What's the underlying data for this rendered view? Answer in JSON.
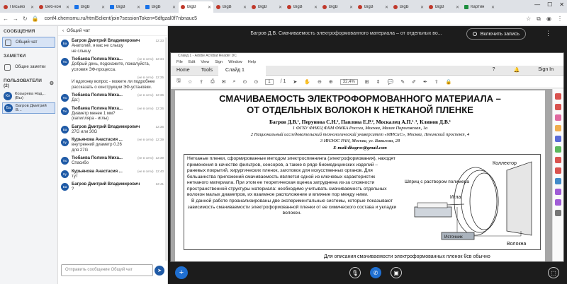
{
  "browser": {
    "tabs": [
      {
        "label": "Письмо",
        "fav": "red"
      },
      {
        "label": "Веб-кон",
        "fav": "red"
      },
      {
        "label": "BigB",
        "fav": "blue"
      },
      {
        "label": "BigB",
        "fav": "blue"
      },
      {
        "label": "BigB",
        "fav": "blue"
      },
      {
        "label": "BigB",
        "fav": "red",
        "active": true
      },
      {
        "label": "BigB",
        "fav": "red"
      },
      {
        "label": "BigB",
        "fav": "red"
      },
      {
        "label": "BigB",
        "fav": "red"
      },
      {
        "label": "BigB",
        "fav": "red"
      },
      {
        "label": "BigB",
        "fav": "red"
      },
      {
        "label": "BigB",
        "fav": "red"
      },
      {
        "label": "BigB",
        "fav": "red"
      },
      {
        "label": "Картин",
        "fav": "green"
      }
    ],
    "url": "conf4.chemsmu.ru/html5client/join?sessionToken=5dfgzal0f7nbnauc5"
  },
  "leftnav": {
    "messages_title": "СООБЩЕНИЯ",
    "public_chat": "Общий чат",
    "notes_title": "ЗАМЕТКИ",
    "shared_notes": "Общие заметки",
    "users_title": "ПОЛЬЗОВАТЕЛИ (2)",
    "users": [
      {
        "initials": "Ко",
        "name": "Козырева Над... (Вы)"
      },
      {
        "initials": "Ба",
        "name": "Багров Дмитрий В..."
      }
    ]
  },
  "chat": {
    "title": "Общий чат",
    "input_placeholder": "Отправить сообщение Общий чат",
    "messages": [
      {
        "initials": "Ба",
        "name": "Багров Дмитрий Владимирович",
        "time": "12:33",
        "status": "",
        "text": "Анатолий, я вас не слышу\nне слышу",
        "color": "#1f5aa6"
      },
      {
        "initials": "Тю",
        "name": "Тюбаева Полина Миха...",
        "time": "12:34",
        "status": "(не в сети)",
        "text": "Добрый день, подскажите, пожалуйста, условия ЭФ-процесса.",
        "color": "#1f5aa6"
      },
      {
        "initials": "",
        "name": "",
        "time": "12:35",
        "status": "(не в сети)",
        "text": "И вдогонку вопрос - можете ли подробнее рассказать о конструкции ЭФ-установки.",
        "color": "#1f5aa6"
      },
      {
        "initials": "Тю",
        "name": "Тюбаева Полина Миха...",
        "time": "12:36",
        "status": "(не в сети)",
        "text": "Да:)",
        "color": "#1f5aa6"
      },
      {
        "initials": "Тю",
        "name": "Тюбаева Полина Миха...",
        "time": "12:36",
        "status": "(не в сети)",
        "text": "Диаметр менее 1 мм?\n(капилляра - иглы)",
        "color": "#1f5aa6"
      },
      {
        "initials": "Ба",
        "name": "Багров Дмитрий Владимирович",
        "time": "12:36",
        "status": "",
        "text": "27G или 30G",
        "color": "#1f5aa6"
      },
      {
        "initials": "Ку",
        "name": "Курьянова Анастасия ...",
        "time": "12:39",
        "status": "(не в сети)",
        "text": "внутренний диаметр 0.26\nдля 27G",
        "color": "#1f5aa6"
      },
      {
        "initials": "Тю",
        "name": "Тюбаева Полина Миха...",
        "time": "12:39",
        "status": "(не в сети)",
        "text": "Спасибо",
        "color": "#1f5aa6"
      },
      {
        "initials": "Ку",
        "name": "Курьянова Анастасия ...",
        "time": "12:40",
        "status": "(не в сети)",
        "text": "тут",
        "color": "#1f5aa6"
      },
      {
        "initials": "Ба",
        "name": "Багров Дмитрий Владимирович",
        "time": "12:41",
        "status": "",
        "text": "?",
        "color": "#1f5aa6"
      }
    ]
  },
  "main": {
    "title": "Багров Д.В. Смачиваемость электроформованного материала – от отдельных во...",
    "record_label": "Включить запись"
  },
  "acrobat": {
    "window_title": "Слайд 1 - Adobe Acrobat Reader DC",
    "menu": [
      "File",
      "Edit",
      "View",
      "Sign",
      "Window",
      "Help"
    ],
    "tab_home": "Home",
    "tab_tools": "Tools",
    "tab_doc": "Слайд 1",
    "sign_in": "Sign In",
    "page_current": "1",
    "page_total": "/ 1",
    "zoom": "32,4%"
  },
  "poster": {
    "title_line1": "СМАЧИВАЕМОСТЬ ЭЛЕКТРОФОРМОВАННОГО МАТЕРИАЛА –",
    "title_line2": "ОТ ОТДЕЛЬНЫХ ВОЛОКОН К НЕТКАНОЙ ПЛЕНКЕ",
    "authors": "Багров Д.В.¹, Перунова С.Н.², Павлова Е.Р.², Москалец А.П.¹˒³, Клинов Д.В.¹",
    "aff1": "1 ФГБУ ФНКЦ ФХМ ФМБА России, Москва, Малая Пироговская, 1а",
    "aff2": "2 Национальный исследовательский технологический университет «МИСиС», Москва, Ленинский проспект, 4",
    "aff3": "3 ИНЭОС РАН, Москва, ул. Вавилова, 28",
    "email": "E-mail:dbagrov@gmail.com",
    "abstract1": "Нетканые пленки, сформированные методом электроспиннинга (электроформования), находят применения в качестве фильтров, сенсоров, а также в ряде биомедицинских изделий – раневых покрытий, хирургических пленок, заготовок для искусственных органов. Для большинства приложений смачиваемость является одной из ключевых характеристик нетканого материала. При этом ее теоретическая оценка затруднена из-за сложности пространственной структуры материала: необходимо учитывать смачиваемость отдельных волокон малых диаметров, их взаимное расположение и влияние пор между ними.",
    "abstract2": "В данной работе проанализированы две экспериментальные системы, которые показывают зависимость смачиваемости электроформованной пленки от ее химического состава и укладки волокон.",
    "fig_collector": "Коллектор",
    "fig_syringe": "Шприц с раствором полимера",
    "fig_needle": "Игла",
    "fig_source": "Источник",
    "fig_fiber": "Волокна",
    "bottom_text": "Для описания смачиваемости электроформованных пленок θсв обычно"
  }
}
